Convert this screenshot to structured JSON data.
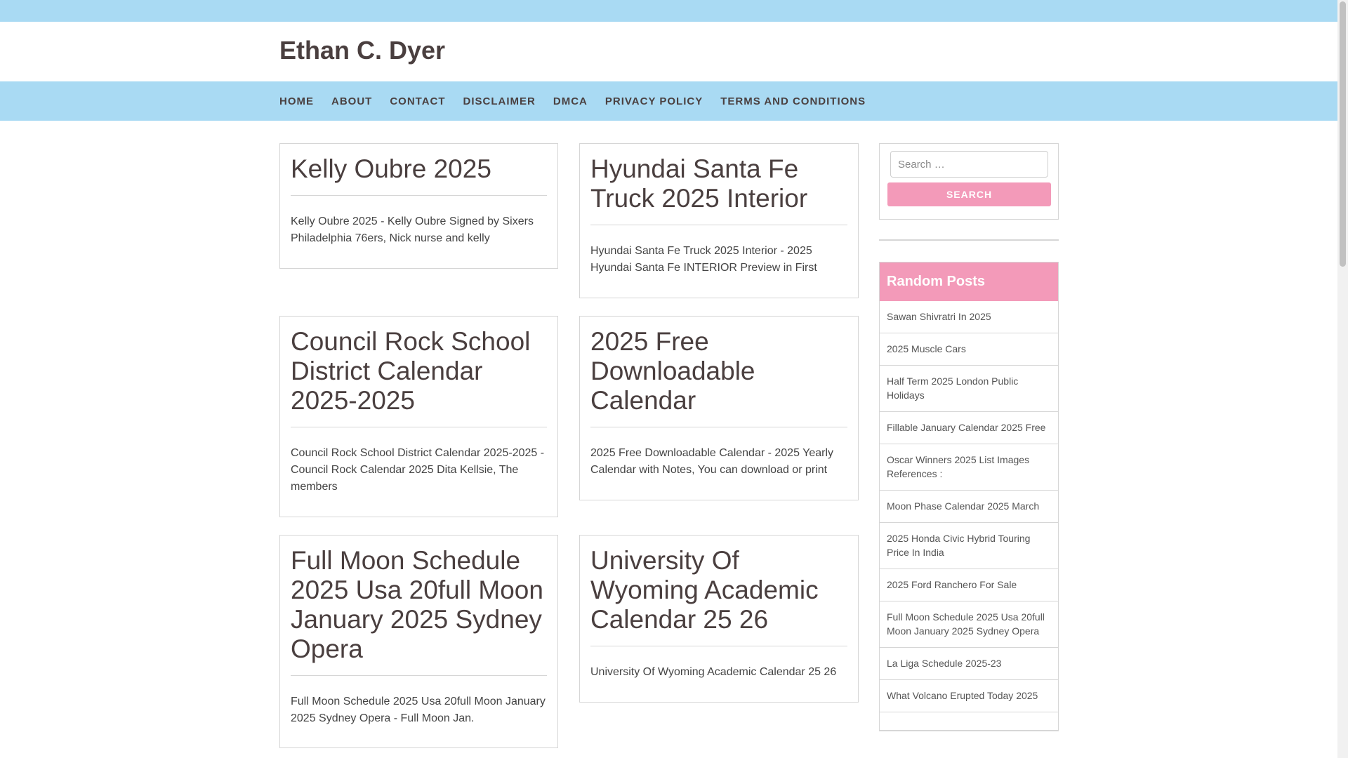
{
  "site": {
    "title": "Ethan C. Dyer"
  },
  "nav": {
    "items": [
      "HOME",
      "ABOUT",
      "CONTACT",
      "DISCLAIMER",
      "DMCA",
      "PRIVACY POLICY",
      "TERMS AND CONDITIONS"
    ]
  },
  "posts": [
    {
      "title": "Kelly Oubre 2025",
      "excerpt": "Kelly Oubre 2025 - Kelly Oubre Signed by Sixers Philadelphia 76ers, Nick nurse and kelly"
    },
    {
      "title": "Hyundai Santa Fe Truck 2025 Interior",
      "excerpt": "Hyundai Santa Fe Truck 2025 Interior - 2025 Hyundai Santa Fe INTERIOR Preview in First"
    },
    {
      "title": "Council Rock School District Calendar 2025-2025",
      "excerpt": "Council Rock School District Calendar 2025-2025 - Council Rock Calendar 2025 Dita Kellsie, The members"
    },
    {
      "title": "2025 Free Downloadable Calendar",
      "excerpt": "2025 Free Downloadable Calendar - 2025 Yearly Calendar with Notes, You can download or print"
    },
    {
      "title": "Full Moon Schedule 2025 Usa 20full Moon January 2025 Sydney Opera",
      "excerpt": "Full Moon Schedule 2025 Usa 20full Moon January 2025 Sydney Opera - Full Moon Jan."
    },
    {
      "title": "University Of Wyoming Academic Calendar 25 26",
      "excerpt": "University Of Wyoming Academic Calendar 25 26"
    }
  ],
  "search": {
    "placeholder": "Search …",
    "button_label": "SEARCH"
  },
  "random_posts": {
    "title": "Random Posts",
    "items": [
      "Sawan Shivratri In 2025",
      "2025 Muscle Cars",
      "Half Term 2025 London Public Holidays",
      "Fillable January Calendar 2025 Free",
      "Oscar Winners 2025 List Images References :",
      "Moon Phase Calendar 2025 March",
      "2025 Honda Civic Hybrid Touring Price In India",
      "2025 Ford Ranchero For Sale",
      "Full Moon Schedule 2025 Usa 20full Moon January 2025 Sydney Opera",
      "La Liga Schedule 2025-23",
      "What Volcano Erupted Today 2025",
      ""
    ]
  },
  "colors": {
    "topbar": "#a9daf3",
    "accent_pink": "#f39ab9",
    "title_text": "#4a3f3f"
  }
}
